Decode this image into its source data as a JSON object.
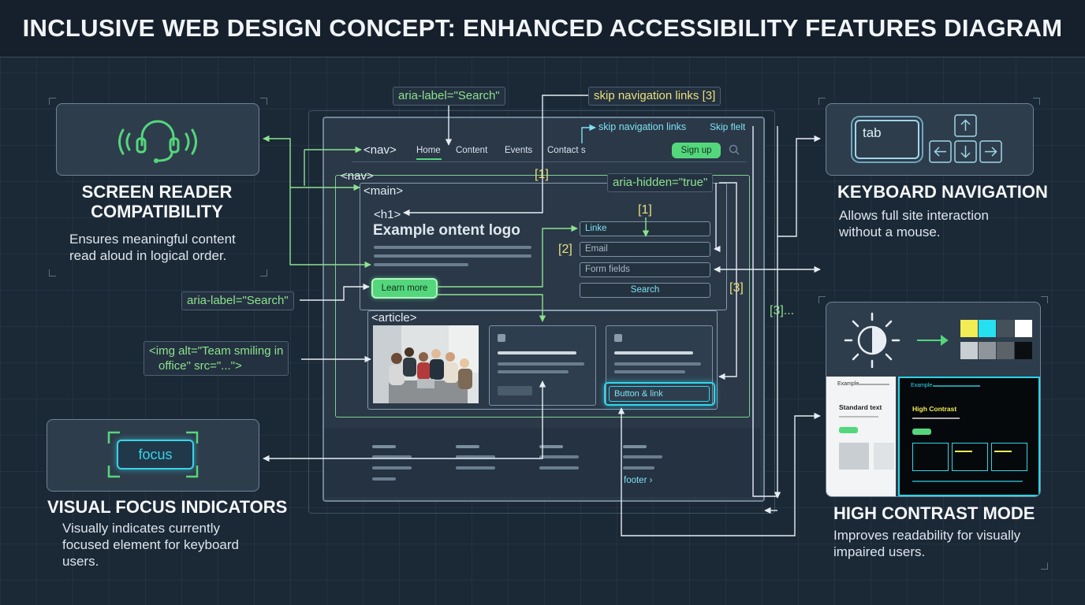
{
  "title": "INCLUSIVE WEB DESIGN CONCEPT: ENHANCED ACCESSIBILITY FEATURES DIAGRAM",
  "features": {
    "screen_reader": {
      "title_line1": "SCREEN READER",
      "title_line2": "COMPATIBILITY",
      "desc_line1": "Ensures meaningful content",
      "desc_line2": "read aloud in logical order."
    },
    "keyboard": {
      "title": "KEYBOARD NAVIGATION",
      "key_label": "tab",
      "desc_line1": "Allows full site interaction",
      "desc_line2": "without a mouse."
    },
    "focus": {
      "title": "VISUAL FOCUS INDICATORS",
      "badge": "focus",
      "desc_line1": "Visually indicates currently",
      "desc_line2": "focused element for keyboard",
      "desc_line3": "users."
    },
    "contrast": {
      "title": "HIGH CONTRAST MODE",
      "desc_line1": "Improves readability for visually",
      "desc_line2": "impaired users.",
      "preview_standard": "Standard text",
      "preview_high": "High Contrast",
      "preview_site": "Example"
    }
  },
  "annotations": {
    "aria_label_top": "aria-label=\"Search\"",
    "skip_nav_top": "skip navigation links [3]",
    "aria_label_left": "aria-label=\"Search\"",
    "img_alt_line1": "<img alt=\"Team smiling in",
    "img_alt_line2": "office\" src=\"...\">",
    "aria_hidden": "aria-hidden=\"true\"",
    "marker_1": "[1]",
    "marker_1b": "[1]",
    "marker_2": "[2]",
    "marker_3": "[3]",
    "marker_3_dots": "[3]..."
  },
  "mockup": {
    "skip_nav": "skip navigation links",
    "skip_flelt": "Skip flelt",
    "nav_tag": "<nav>",
    "nav_tag_2": "<nav>",
    "main_tag": "<main>",
    "h1_tag": "<h1>",
    "heading": "Example ontent logo",
    "article_tag": "<article>",
    "nav_links": [
      "Home",
      "Content",
      "Events",
      "Contact s"
    ],
    "signup": "Sign up",
    "form_fields": [
      "Linke",
      "Email",
      "Form fields"
    ],
    "search_button": "Search",
    "learn_more": "Learn more",
    "button_link": "Button & link",
    "footer": "footer ›"
  },
  "colors": {
    "accent_green": "#54d77c",
    "accent_cyan": "#38d4e8",
    "annotation_yellow": "#e9e07a",
    "background": "#1b2836"
  }
}
